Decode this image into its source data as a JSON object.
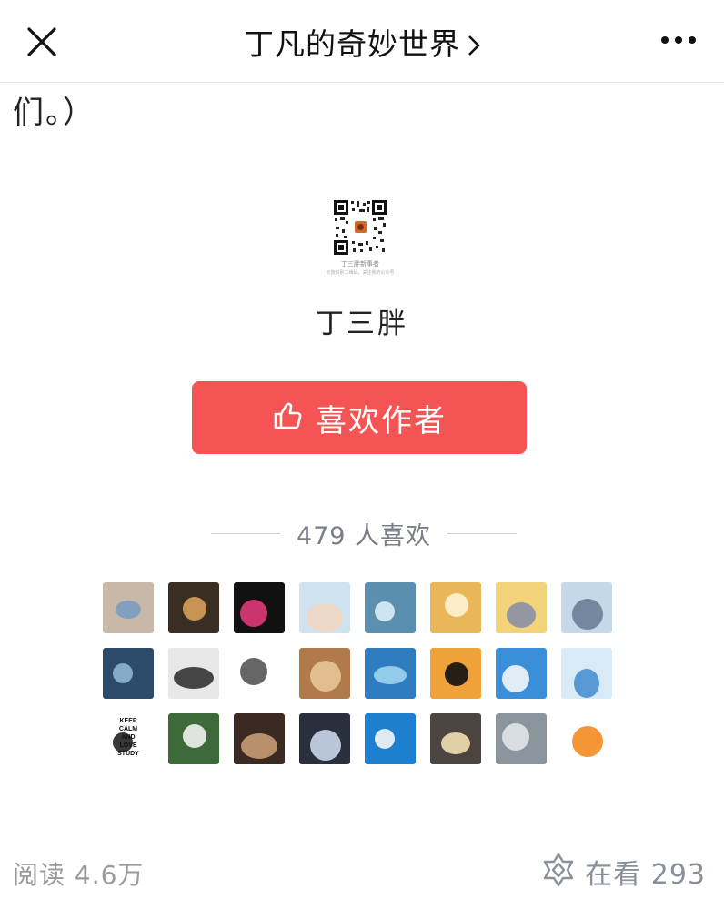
{
  "nav": {
    "title": "丁凡的奇妙世界",
    "close_icon": "close-icon",
    "more_icon": "more-dots-icon"
  },
  "article": {
    "tail_text": "们。）"
  },
  "reward": {
    "qr_name": "丁三胖新事者",
    "qr_hint": "长按识别二维码，关注我的公众号",
    "author_name": "丁三胖",
    "like_button_label": "喜欢作者",
    "like_icon": "thumbs-up-icon",
    "likes_count_text": "479 人喜欢",
    "button_color": "#f45454"
  },
  "avatars": [
    {
      "name": "avatar-1",
      "bg": "#c8b8a8",
      "accent": "#7a9cc0"
    },
    {
      "name": "avatar-2",
      "bg": "#3a2e22",
      "accent": "#d8a05a"
    },
    {
      "name": "avatar-3",
      "bg": "#111111",
      "accent": "#e03a7a"
    },
    {
      "name": "avatar-4",
      "bg": "#cfe2ef",
      "accent": "#f0d6c2"
    },
    {
      "name": "avatar-5",
      "bg": "#5b8fb0",
      "accent": "#d9ecf5"
    },
    {
      "name": "avatar-6",
      "bg": "#e9b65a",
      "accent": "#fff2d0"
    },
    {
      "name": "avatar-7",
      "bg": "#f2d37a",
      "accent": "#8a8fa6"
    },
    {
      "name": "avatar-8",
      "bg": "#c4d8ea",
      "accent": "#6a7f96"
    },
    {
      "name": "avatar-9",
      "bg": "#2c4b6a",
      "accent": "#8fb5d0"
    },
    {
      "name": "avatar-10",
      "bg": "#e8e8e8",
      "accent": "#333333"
    },
    {
      "name": "avatar-11",
      "bg": "#ffffff",
      "accent": "#555555"
    },
    {
      "name": "avatar-12",
      "bg": "#b07a4a",
      "accent": "#e8c596"
    },
    {
      "name": "avatar-13",
      "bg": "#2f7cc0",
      "accent": "#9fd4f0"
    },
    {
      "name": "avatar-14",
      "bg": "#f0a23a",
      "accent": "#111111"
    },
    {
      "name": "avatar-15",
      "bg": "#3b8ed8",
      "accent": "#f3f6fa"
    },
    {
      "name": "avatar-16",
      "bg": "#d7eaf5",
      "accent": "#4d8fcf"
    },
    {
      "name": "avatar-17",
      "bg": "#ffffff",
      "accent": "#222222"
    },
    {
      "name": "avatar-18",
      "bg": "#3e6a3a",
      "accent": "#f2f2f2"
    },
    {
      "name": "avatar-19",
      "bg": "#3b2a22",
      "accent": "#c79b74"
    },
    {
      "name": "avatar-20",
      "bg": "#2a2f3e",
      "accent": "#c9d6ea"
    },
    {
      "name": "avatar-21",
      "bg": "#1d7fcf",
      "accent": "#f5f5f5"
    },
    {
      "name": "avatar-22",
      "bg": "#4b4440",
      "accent": "#f2e0b0"
    },
    {
      "name": "avatar-23",
      "bg": "#8c949c",
      "accent": "#dfe4ea"
    },
    {
      "name": "avatar-24",
      "bg": "#ffffff",
      "accent": "#f58a1f"
    }
  ],
  "avatar_texts": {
    "keep_calm_lines": [
      "KEEP",
      "CALM",
      "AND",
      "LOVE",
      "STUDY"
    ]
  },
  "footer": {
    "read_text": "阅读 4.6万",
    "watch_icon": "wow-star-icon",
    "watch_text": "在看 293"
  }
}
